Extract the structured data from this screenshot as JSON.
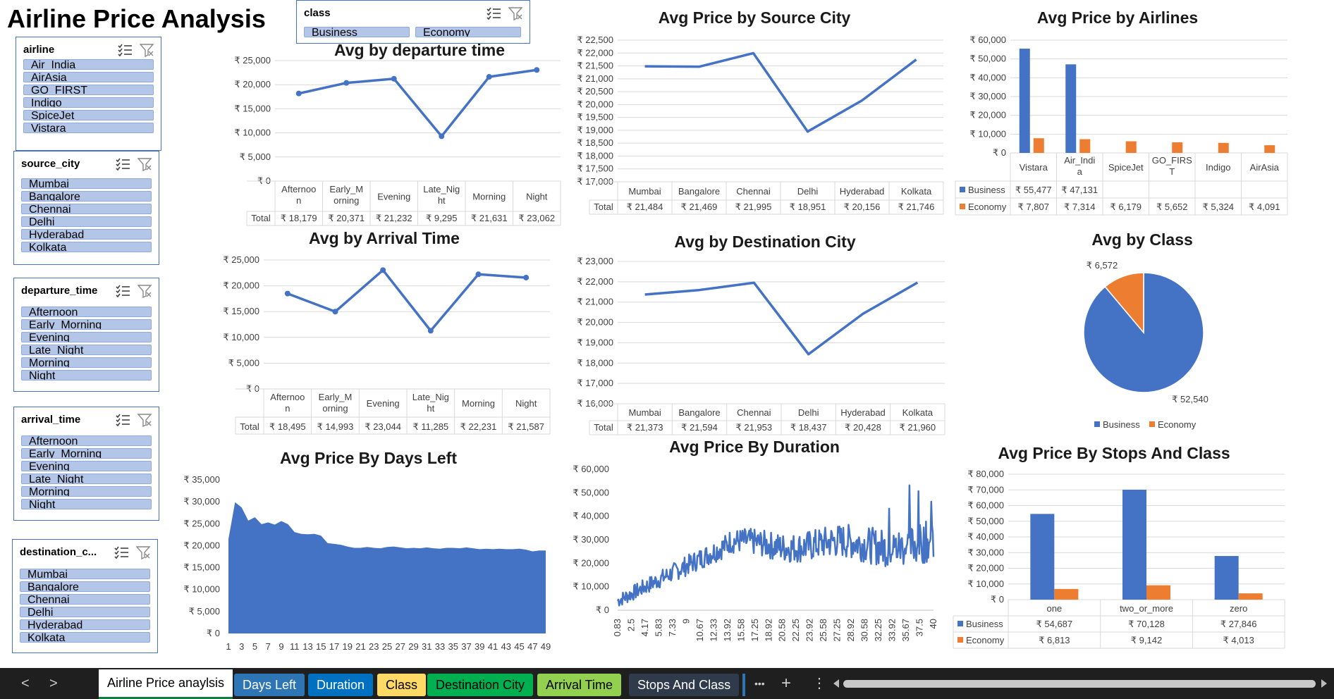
{
  "dashboard": {
    "title": "Airline Price Analysis"
  },
  "slicers": {
    "airline": {
      "title": "airline",
      "items": [
        "Air_India",
        "AirAsia",
        "GO_FIRST",
        "Indigo",
        "SpiceJet",
        "Vistara"
      ]
    },
    "source_city": {
      "title": "source_city",
      "items": [
        "Mumbai",
        "Bangalore",
        "Chennai",
        "Delhi",
        "Hyderabad",
        "Kolkata"
      ]
    },
    "departure_time": {
      "title": "departure_time",
      "items": [
        "Afternoon",
        "Early_Morning",
        "Evening",
        "Late_Night",
        "Morning",
        "Night"
      ]
    },
    "arrival_time": {
      "title": "arrival_time",
      "items": [
        "Afternoon",
        "Early_Morning",
        "Evening",
        "Late_Night",
        "Morning",
        "Night"
      ]
    },
    "destination_city": {
      "title": "destination_c...",
      "items": [
        "Mumbai",
        "Bangalore",
        "Chennai",
        "Delhi",
        "Hyderabad",
        "Kolkata"
      ]
    },
    "class": {
      "title": "class",
      "items": [
        "Business",
        "Economy"
      ]
    }
  },
  "chart_data": [
    {
      "id": "departure",
      "type": "line",
      "title": "Avg by departure time",
      "categories": [
        "Afternoon",
        "Early_Morning",
        "Evening",
        "Late_Night",
        "Morning",
        "Night"
      ],
      "values": [
        18179,
        20371,
        21232,
        9295,
        21631,
        23062
      ],
      "table_row": {
        "label": "Total",
        "values": [
          "₹ 18,179",
          "₹ 20,371",
          "₹ 21,232",
          "₹ 9,295",
          "₹ 21,631",
          "₹ 23,062"
        ]
      },
      "yticks": [
        "₹ 0",
        "₹ 5,000",
        "₹ 10,000",
        "₹ 15,000",
        "₹ 20,000",
        "₹ 25,000"
      ],
      "ylim": [
        0,
        25000
      ]
    },
    {
      "id": "arrival",
      "type": "line",
      "title": "Avg by Arrival Time",
      "categories": [
        "Afternoon",
        "Early_Morning",
        "Evening",
        "Late_Night",
        "Morning",
        "Night"
      ],
      "values": [
        18495,
        14993,
        23044,
        11285,
        22231,
        21587
      ],
      "table_row": {
        "label": "Total",
        "values": [
          "₹ 18,495",
          "₹ 14,993",
          "₹ 23,044",
          "₹ 11,285",
          "₹ 22,231",
          "₹ 21,587"
        ]
      },
      "yticks": [
        "₹ 0",
        "₹ 5,000",
        "₹ 10,000",
        "₹ 15,000",
        "₹ 20,000",
        "₹ 25,000"
      ],
      "ylim": [
        0,
        25000
      ]
    },
    {
      "id": "source",
      "type": "line",
      "title": "Avg Price by Source City",
      "categories": [
        "Mumbai",
        "Bangalore",
        "Chennai",
        "Delhi",
        "Hyderabad",
        "Kolkata"
      ],
      "values": [
        21484,
        21469,
        21995,
        18951,
        20156,
        21746
      ],
      "table_row": {
        "label": "Total",
        "values": [
          "₹ 21,484",
          "₹ 21,469",
          "₹ 21,995",
          "₹ 18,951",
          "₹ 20,156",
          "₹ 21,746"
        ]
      },
      "yticks": [
        "₹ 17,000",
        "₹ 17,500",
        "₹ 18,000",
        "₹ 18,500",
        "₹ 19,000",
        "₹ 19,500",
        "₹ 20,000",
        "₹ 20,500",
        "₹ 21,000",
        "₹ 21,500",
        "₹ 22,000",
        "₹ 22,500"
      ],
      "ylim": [
        17000,
        22500
      ]
    },
    {
      "id": "destination",
      "type": "line",
      "title": "Avg by Destination City",
      "categories": [
        "Mumbai",
        "Bangalore",
        "Chennai",
        "Delhi",
        "Hyderabad",
        "Kolkata"
      ],
      "values": [
        21373,
        21594,
        21953,
        18437,
        20428,
        21960
      ],
      "table_row": {
        "label": "Total",
        "values": [
          "₹ 21,373",
          "₹ 21,594",
          "₹ 21,953",
          "₹ 18,437",
          "₹ 20,428",
          "₹ 21,960"
        ]
      },
      "yticks": [
        "₹ 16,000",
        "₹ 17,000",
        "₹ 18,000",
        "₹ 19,000",
        "₹ 20,000",
        "₹ 21,000",
        "₹ 22,000",
        "₹ 23,000"
      ],
      "ylim": [
        16000,
        23000
      ]
    },
    {
      "id": "airlines",
      "type": "bar",
      "title": "Avg Price by Airlines",
      "categories": [
        "Vistara",
        "Air_India",
        "SpiceJet",
        "GO_FIRST",
        "Indigo",
        "AirAsia"
      ],
      "category_labels": [
        "Vistara",
        "Air_Indi a",
        "SpiceJet",
        "GO_FIRS T",
        "Indigo",
        "AirAsia"
      ],
      "series": [
        {
          "name": "Business",
          "values": [
            55477,
            47131,
            null,
            null,
            null,
            null
          ],
          "labels": [
            "₹ 55,477",
            "₹ 47,131",
            "",
            "",
            "",
            ""
          ]
        },
        {
          "name": "Economy",
          "values": [
            7807,
            7314,
            6179,
            5652,
            5324,
            4091
          ],
          "labels": [
            "₹ 7,807",
            "₹ 7,314",
            "₹ 6,179",
            "₹ 5,652",
            "₹ 5,324",
            "₹ 4,091"
          ]
        }
      ],
      "yticks": [
        "₹ 0",
        "₹ 10,000",
        "₹ 20,000",
        "₹ 30,000",
        "₹ 40,000",
        "₹ 50,000",
        "₹ 60,000"
      ],
      "ylim": [
        0,
        60000
      ]
    },
    {
      "id": "class",
      "type": "pie",
      "title": "Avg by Class",
      "slices": [
        {
          "name": "Business",
          "value": 52540,
          "label": "₹ 52,540"
        },
        {
          "name": "Economy",
          "value": 6572,
          "label": "₹ 6,572"
        }
      ]
    },
    {
      "id": "stops",
      "type": "bar",
      "title": "Avg Price By Stops And Class",
      "categories": [
        "one",
        "two_or_more",
        "zero"
      ],
      "series": [
        {
          "name": "Business",
          "values": [
            54687,
            70128,
            27846
          ],
          "labels": [
            "₹ 54,687",
            "₹ 70,128",
            "₹ 27,846"
          ]
        },
        {
          "name": "Economy",
          "values": [
            6813,
            9142,
            4013
          ],
          "labels": [
            "₹ 6,813",
            "₹ 9,142",
            "₹ 4,013"
          ]
        }
      ],
      "yticks": [
        "₹ 0",
        "₹ 10,000",
        "₹ 20,000",
        "₹ 30,000",
        "₹ 40,000",
        "₹ 50,000",
        "₹ 60,000",
        "₹ 70,000",
        "₹ 80,000"
      ],
      "ylim": [
        0,
        80000
      ]
    },
    {
      "id": "daysleft",
      "type": "area",
      "title": "Avg Price By Days Left",
      "x": [
        1,
        2,
        3,
        4,
        5,
        6,
        7,
        8,
        9,
        10,
        11,
        12,
        13,
        14,
        15,
        16,
        17,
        18,
        19,
        20,
        21,
        22,
        23,
        24,
        25,
        26,
        27,
        28,
        29,
        30,
        31,
        32,
        33,
        34,
        35,
        36,
        37,
        38,
        39,
        40,
        41,
        42,
        43,
        44,
        45,
        46,
        47,
        48,
        49
      ],
      "values": [
        21500,
        29900,
        28700,
        25700,
        26500,
        24900,
        25300,
        24800,
        25600,
        24900,
        23100,
        22700,
        22600,
        22700,
        22300,
        20600,
        20400,
        20200,
        19800,
        19500,
        19500,
        19700,
        19500,
        19400,
        19700,
        19800,
        19600,
        19400,
        19500,
        19400,
        19600,
        19400,
        19300,
        19500,
        19500,
        19400,
        19600,
        19400,
        19200,
        19300,
        19200,
        19300,
        19200,
        19200,
        19300,
        19100,
        18700,
        18900,
        18900
      ],
      "xticks": [
        "1",
        "3",
        "5",
        "7",
        "9",
        "11",
        "13",
        "15",
        "17",
        "19",
        "21",
        "23",
        "25",
        "27",
        "29",
        "31",
        "33",
        "35",
        "37",
        "39",
        "41",
        "43",
        "45",
        "47",
        "49"
      ],
      "yticks": [
        "₹ 0",
        "₹ 5,000",
        "₹ 10,000",
        "₹ 15,000",
        "₹ 20,000",
        "₹ 25,000",
        "₹ 30,000",
        "₹ 35,000"
      ],
      "ylim": [
        0,
        35000
      ]
    },
    {
      "id": "duration",
      "type": "line",
      "title": "Avg Price By Duration",
      "xticks": [
        "0.83",
        "2.5",
        "4.17",
        "5.83",
        "7.33",
        "9",
        "10.67",
        "12.33",
        "13.92",
        "15.58",
        "17.25",
        "18.92",
        "20.58",
        "22.25",
        "23.92",
        "25.58",
        "27.25",
        "28.92",
        "30.58",
        "32.25",
        "33.92",
        "35.67",
        "37.5",
        "40"
      ],
      "yticks": [
        "₹ 0",
        "₹ 10,000",
        "₹ 20,000",
        "₹ 30,000",
        "₹ 40,000",
        "₹ 50,000",
        "₹ 60,000"
      ],
      "ylim": [
        0,
        60000
      ]
    }
  ],
  "sheet_tabs": {
    "active": "Airline Price anaylsis",
    "tabs": [
      {
        "label": "Days Left",
        "color": "#2e75b6"
      },
      {
        "label": "Duration",
        "color": "#0070c0"
      },
      {
        "label": "Class",
        "color": "#ffd966"
      },
      {
        "label": "Destination City",
        "color": "#00b050"
      },
      {
        "label": "Arrival Time",
        "color": "#92d050"
      },
      {
        "label": "Stops And Class",
        "color": "#2f3a4a"
      }
    ],
    "more_label": "•••",
    "add_label": "+",
    "menu_label": "⋮",
    "prev_label": "<",
    "next_label": ">"
  },
  "legend": {
    "business": "Business",
    "economy": "Economy"
  },
  "colors": {
    "business": "#4472c4",
    "economy": "#ed7d31",
    "slicer_item": "#b4c6e7",
    "tabbar": "#1f1f1f"
  }
}
